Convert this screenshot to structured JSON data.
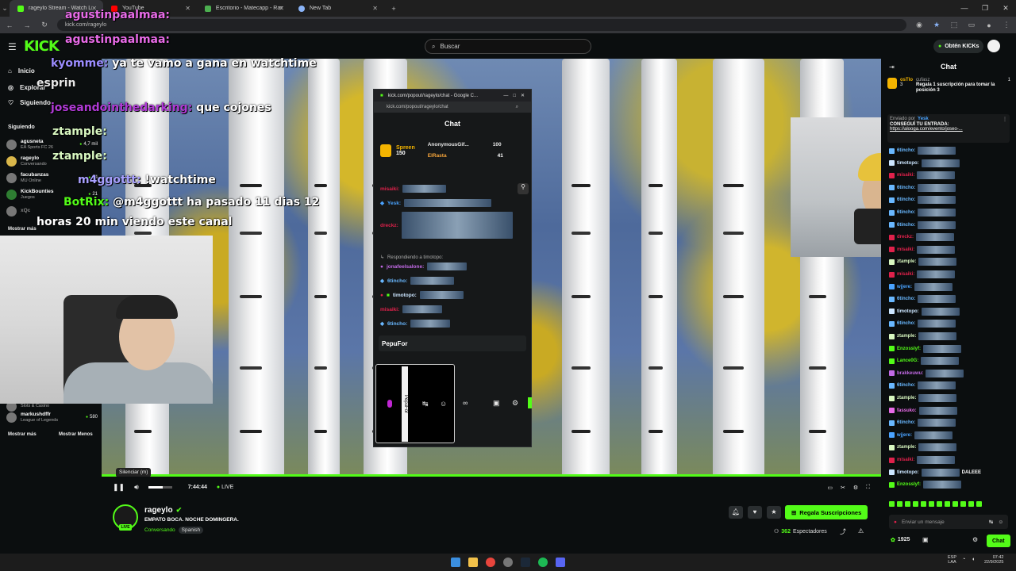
{
  "browser": {
    "tabs": [
      {
        "label": "rageylo Stream - Watch Live on Kick",
        "active": true,
        "color": "#53fc18"
      },
      {
        "label": "YouTube",
        "active": false,
        "color": "#ff0000"
      },
      {
        "label": "Escritorio - Matecapp - Ranking",
        "active": false,
        "color": "#4caf50"
      },
      {
        "label": "New Tab",
        "active": false,
        "color": "#8ab4f8"
      }
    ],
    "url": "kick.com/rageylo"
  },
  "header": {
    "logo": "KICK",
    "search_placeholder": "Buscar",
    "obtain_button": "Obtén KICKs"
  },
  "sidebar": {
    "nav": [
      {
        "label": "Inicio",
        "icon": "home-icon"
      },
      {
        "label": "Explorar",
        "icon": "compass-icon"
      },
      {
        "label": "Siguiendo",
        "icon": "heart-icon"
      }
    ],
    "following_title": "Siguiendo",
    "following": [
      {
        "name": "agusneta",
        "sub": "EA Sports FC 26",
        "count": "4,7 mil"
      },
      {
        "name": "rageylo",
        "sub": "Conversando",
        "count": ""
      },
      {
        "name": "facubanzas",
        "sub": "MU Online",
        "count": "34"
      },
      {
        "name": "KickBounties",
        "sub": "Juegos",
        "count": "21"
      },
      {
        "name": "xQc",
        "sub": "",
        "count": ""
      }
    ],
    "show_more_top": "Mostrar más",
    "following_bottom": [
      {
        "name": "",
        "sub": "Slots & Casino",
        "count": ""
      },
      {
        "name": "markushdffr",
        "sub": "League of Legends",
        "count": "580"
      }
    ],
    "show_more": "Mostrar más",
    "show_less": "Mostrar Menos"
  },
  "stream_overlay": {
    "lines": [
      {
        "user": "agustinpaalmaa:",
        "text": "",
        "color": "#e86be8"
      },
      {
        "user": "agustinpaalmaa:",
        "text": "",
        "color": "#e86be8"
      },
      {
        "user": "kyomme:",
        "text": "ya te vamo a gana en watchtime",
        "color": "#9b8cff"
      },
      {
        "user": "esprin",
        "text": "",
        "color": "#ffffff"
      },
      {
        "user": "joseandointhedarking:",
        "text": "que cojones",
        "color": "#b03ad6"
      },
      {
        "user": "ztample:",
        "text": "",
        "color": "#d8f7c0"
      },
      {
        "user": "ztample:",
        "text": "",
        "color": "#d8f7c0"
      },
      {
        "user": "m4ggottt:",
        "text": "!watchtime",
        "color": "#a8a0ff"
      },
      {
        "user": "BotRix:",
        "text": "@m4ggottt ha pasado 11 dias 12",
        "color": "#53fc18"
      },
      {
        "user": "",
        "text": "horas 20 min viendo este canal",
        "color": "#ffffff"
      }
    ]
  },
  "popout": {
    "window_title": "kick.com/popout/rageylo/chat - Google C...",
    "url": "kick.com/popout/rageylo/chat",
    "chat_title": "Chat",
    "leader_top": {
      "name": "Spreen",
      "value": "150"
    },
    "leader_right": [
      {
        "name": "AnonymousGif...",
        "value": "100"
      },
      {
        "name": "ElRasta",
        "value": "41"
      }
    ],
    "lines": [
      {
        "user": "misaiki:",
        "color": "#e0214b"
      },
      {
        "user": "Yesk:",
        "color": "#4aa3ff"
      },
      {
        "user": "dreckz:",
        "color": "#e0214b"
      },
      {
        "user": "Respondiendo a timotopo:",
        "color": "#aaaaaa"
      },
      {
        "user": "jonafeelsalone:",
        "color": "#c26ae6"
      },
      {
        "user": "6tincho:",
        "color": "#69b8ff"
      },
      {
        "user": "timotopo:",
        "color": "#cce6ff"
      },
      {
        "user": "misaiki:",
        "color": "#e0214b"
      },
      {
        "user": "6tincho:",
        "color": "#69b8ff"
      }
    ],
    "input_user": "PepuFor",
    "vertical_text": "PepuFor"
  },
  "player": {
    "tooltip": "Silenciar (m)",
    "time": "7:44:44",
    "live_label": "LIVE",
    "volume": 0.6
  },
  "channel": {
    "name": "rageylo",
    "title": "EMPATO BOCA. NOCHE DOMINGERA.",
    "category": "Conversando",
    "language": "Spanish",
    "subscribe_button": "Regala Suscripciones",
    "viewers": "362",
    "viewers_label": "Espectadores",
    "live_badge": "LIVE"
  },
  "chat": {
    "title": "Chat",
    "pinned_user": "osTlo",
    "pinned_count": "3",
    "pinned_sub_user": "cufasz",
    "pinned_sub_count": "1",
    "gift_text": "Regala 1 suscripción para tomar la posición 3",
    "sent_by_label": "Enviado por",
    "sent_by_user": "Yesk",
    "announce": "CONSEGUÍ TU ENTRADA:",
    "announce_link": "https://alooga.com/evento/joseo-...",
    "messages": [
      {
        "user": "6tincho:",
        "color": "#69b8ff"
      },
      {
        "user": "timotopo:",
        "color": "#cce6ff"
      },
      {
        "user": "misaiki:",
        "color": "#e0214b"
      },
      {
        "user": "6tincho:",
        "color": "#69b8ff"
      },
      {
        "user": "6tincho:",
        "color": "#69b8ff"
      },
      {
        "user": "6tincho:",
        "color": "#69b8ff"
      },
      {
        "user": "6tincho:",
        "color": "#69b8ff"
      },
      {
        "user": "dreckz:",
        "color": "#e0214b"
      },
      {
        "user": "misaiki:",
        "color": "#e0214b"
      },
      {
        "user": "ztample:",
        "color": "#d8f7c0"
      },
      {
        "user": "misaiki:",
        "color": "#e0214b"
      },
      {
        "user": "wjjere:",
        "color": "#4aa3ff"
      },
      {
        "user": "6tincho:",
        "color": "#69b8ff"
      },
      {
        "user": "timotopo:",
        "color": "#cce6ff"
      },
      {
        "user": "6tincho:",
        "color": "#69b8ff"
      },
      {
        "user": "ztample:",
        "color": "#d8f7c0"
      },
      {
        "user": "Enzosslyf:",
        "color": "#53fc18"
      },
      {
        "user": "Lance0G:",
        "color": "#53fc18"
      },
      {
        "user": "brakkeuwu:",
        "color": "#c26ae6"
      },
      {
        "user": "6tincho:",
        "color": "#69b8ff"
      },
      {
        "user": "ztample:",
        "color": "#d8f7c0"
      },
      {
        "user": "fassuko:",
        "color": "#e86be8"
      },
      {
        "user": "6tincho:",
        "color": "#69b8ff"
      },
      {
        "user": "wjjere:",
        "color": "#4aa3ff"
      },
      {
        "user": "ztample:",
        "color": "#d8f7c0"
      },
      {
        "user": "misaiki:",
        "color": "#e0214b"
      },
      {
        "user": "timotopo:",
        "color": "#cce6ff"
      },
      {
        "user": "Enzosslyf:",
        "color": "#53fc18"
      }
    ],
    "last_message_text": "DALEEE",
    "input_placeholder": "Enviar un mensaje",
    "points": "1925",
    "send_button": "Chat"
  },
  "taskbar": {
    "lang": "ESP",
    "lang_sub": "LAA",
    "time": "07:42",
    "date": "22/9/2025"
  },
  "colors": {
    "accent": "#53fc18",
    "bg": "#0b0e0f"
  }
}
